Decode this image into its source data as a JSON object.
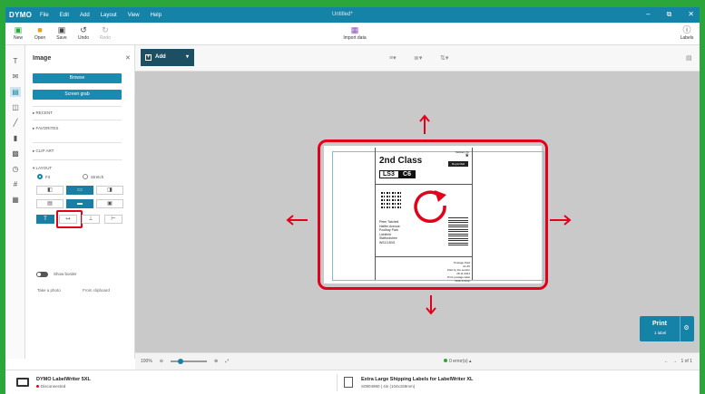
{
  "app": {
    "logo": "DYMO",
    "doc_title": "Untitled*"
  },
  "menu": [
    "File",
    "Edit",
    "Add",
    "Layout",
    "View",
    "Help"
  ],
  "window_controls": [
    "minimize-icon",
    "restore-icon",
    "close-icon"
  ],
  "toolbar": {
    "new": "New",
    "open": "Open",
    "save": "Save",
    "undo": "Undo",
    "redo": "Redo",
    "import": "Import data",
    "labels": "Labels"
  },
  "side_panel": {
    "title": "Image",
    "browse": "Browse",
    "screen_grab": "Screen grab",
    "recent": "RECENT",
    "favorites": "FAVORITES",
    "clip_art": "CLIP ART",
    "layout": "LAYOUT",
    "fit": "Fit",
    "stretch": "Stretch",
    "show_border": "Show border",
    "take_photo": "Take a photo",
    "from_clipboard": "From clipboard"
  },
  "canvas_toolbar": {
    "add": "Add"
  },
  "label": {
    "class": "2nd Class",
    "code_left": "LS3",
    "code_right": "C6",
    "royal_mail_line1": "Delivery To",
    "royal_mail_line2": "Royal Mail",
    "royal_mail_box": "Royal Mail",
    "address": [
      "Peter Tatchell",
      "Hallfer Avenue",
      "Poolbay Park",
      "Lichfield",
      "Staffordshire",
      "WS13 8DS"
    ],
    "postage": [
      "Postage Paid",
      "£1.45",
      "Paid by the sender",
      "28.11.2021",
      "Print postage label",
      "Click & Drop"
    ]
  },
  "bottom": {
    "zoom": "100%",
    "errors": "0 error(s)",
    "pager": "1 of 1"
  },
  "print": {
    "label": "Print",
    "sub": "1 label"
  },
  "status": {
    "printer": "DYMO LabelWriter 5XL",
    "printer_status": "Disconnected",
    "label_name": "Extra Large Shipping Labels for LabelWriter XL",
    "label_sub": "S0904980 | 4in (104x159mm)"
  },
  "colors": {
    "brand": "#1582a8",
    "highlight": "#e3001b",
    "frame": "#2aa63a"
  }
}
